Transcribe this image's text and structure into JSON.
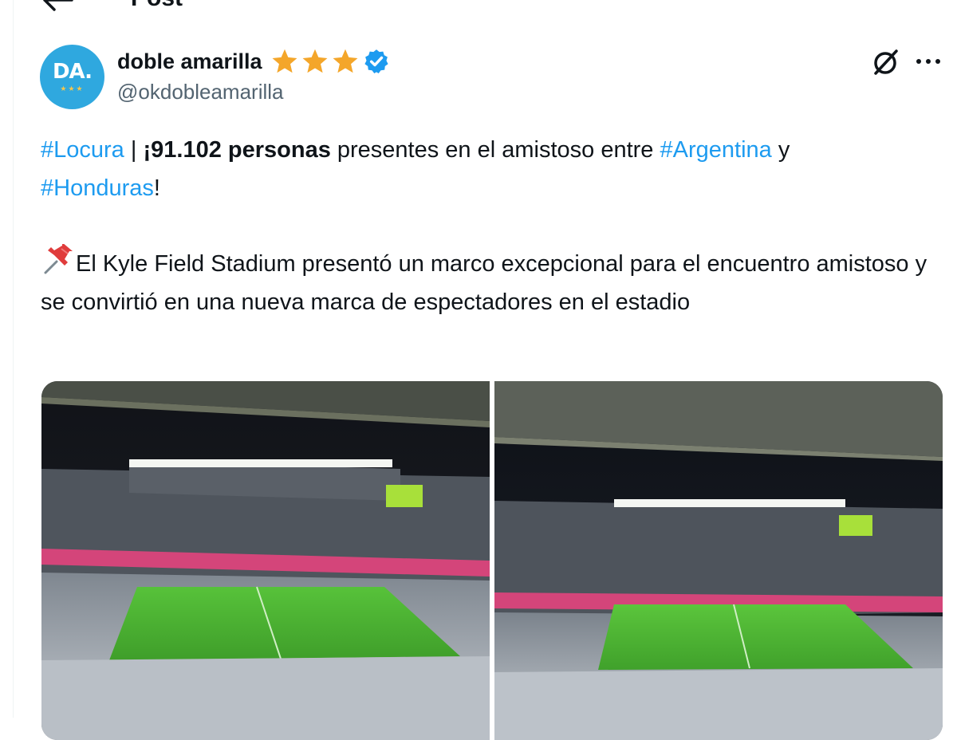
{
  "header": {
    "title": "Post"
  },
  "author": {
    "avatar_text": "DA.",
    "avatar_stars": "★★★",
    "display_name": "doble amarilla",
    "handle": "@okdobleamarilla"
  },
  "post": {
    "line1": {
      "tag1": "#Locura",
      "sep": " | ",
      "bold": "¡91.102 personas",
      "mid": " presentes en el amistoso entre ",
      "tag2": "#Argentina",
      "end": " y"
    },
    "line2": {
      "tag3": "#Honduras",
      "end": "!"
    },
    "paragraph2": "El Kyle Field Stadium presentó un marco excepcional para el encuentro amistoso y se convirtió en una nueva marca de espectadores en el estadio"
  },
  "colors": {
    "accent": "#1d9bf0",
    "avatar_bg": "#2fa8df",
    "star": "#f4a62a",
    "verified": "#1d9bf0",
    "secondary_text": "#536471"
  },
  "icons": {
    "back": "arrow-left-icon",
    "stars": "star-icon",
    "verified": "verified-badge-icon",
    "grok": "grok-icon",
    "more": "more-icon",
    "pin": "pushpin-icon"
  },
  "media": {
    "count": 2
  }
}
